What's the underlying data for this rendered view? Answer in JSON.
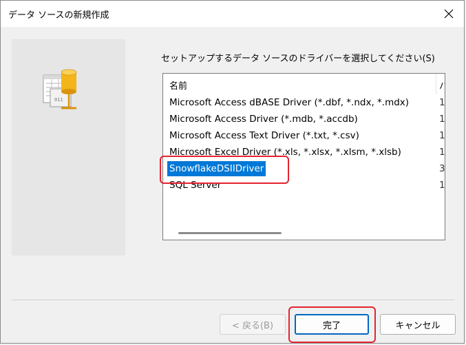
{
  "window": {
    "title": "データ ソースの新規作成",
    "close_icon": "close-icon"
  },
  "prompt": "セットアップするデータ ソースのドライバーを選択してください(S)",
  "list": {
    "columns": {
      "name": "名前",
      "version": "バ"
    },
    "rows": [
      {
        "name": "Microsoft Access dBASE Driver (*.dbf, *.ndx, *.mdx)",
        "version": "1"
      },
      {
        "name": "Microsoft Access Driver (*.mdb, *.accdb)",
        "version": "1"
      },
      {
        "name": "Microsoft Access Text Driver (*.txt, *.csv)",
        "version": "1"
      },
      {
        "name": "Microsoft Excel Driver (*.xls, *.xlsx, *.xlsm, *.xlsb)",
        "version": "1"
      },
      {
        "name": "SnowflakeDSIIDriver",
        "version": "3",
        "selected": true
      },
      {
        "name": "SQL Server",
        "version": "1"
      }
    ]
  },
  "buttons": {
    "back": "< 戻る(B)",
    "finish": "完了",
    "cancel": "キャンセル"
  },
  "colors": {
    "selection": "#0078d7",
    "highlight": "#e3232e",
    "default_button_border": "#0067c0"
  }
}
